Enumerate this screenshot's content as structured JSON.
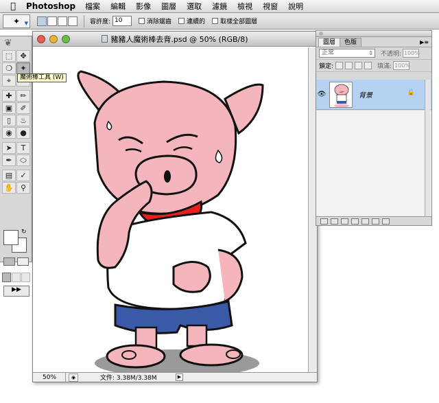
{
  "menubar": {
    "app_name": "Photoshop",
    "items": [
      "檔案",
      "編輯",
      "影像",
      "圖層",
      "選取",
      "濾鏡",
      "檢視",
      "視窗",
      "說明"
    ]
  },
  "options_bar": {
    "tolerance_label": "容許度:",
    "tolerance_value": "10",
    "anti_alias_label": "消除鋸齒",
    "contiguous_label": "連續的",
    "sample_all_label": "取樣全部圖層"
  },
  "tooltip": {
    "text": "魔術棒工具 (W)"
  },
  "document": {
    "title": "豬豬人魔術棒去背.psd @ 50% (RGB/8)",
    "zoom": "50%",
    "file_info": "文件: 3.38M/3.38M"
  },
  "layers_panel": {
    "tabs": [
      "圖層",
      "色版"
    ],
    "blend_mode": "正常",
    "opacity_label": "不透明:",
    "opacity_value": "100%",
    "lock_label": "鎖定:",
    "fill_label": "填滿:",
    "fill_value": "100%",
    "layer_name": "背景"
  },
  "colors": {
    "pig_pink": "#f4b6bc",
    "shorts_blue": "#3a5aa8",
    "mouth_red": "#e81f1f",
    "layer_selected": "#b5d2f3"
  }
}
